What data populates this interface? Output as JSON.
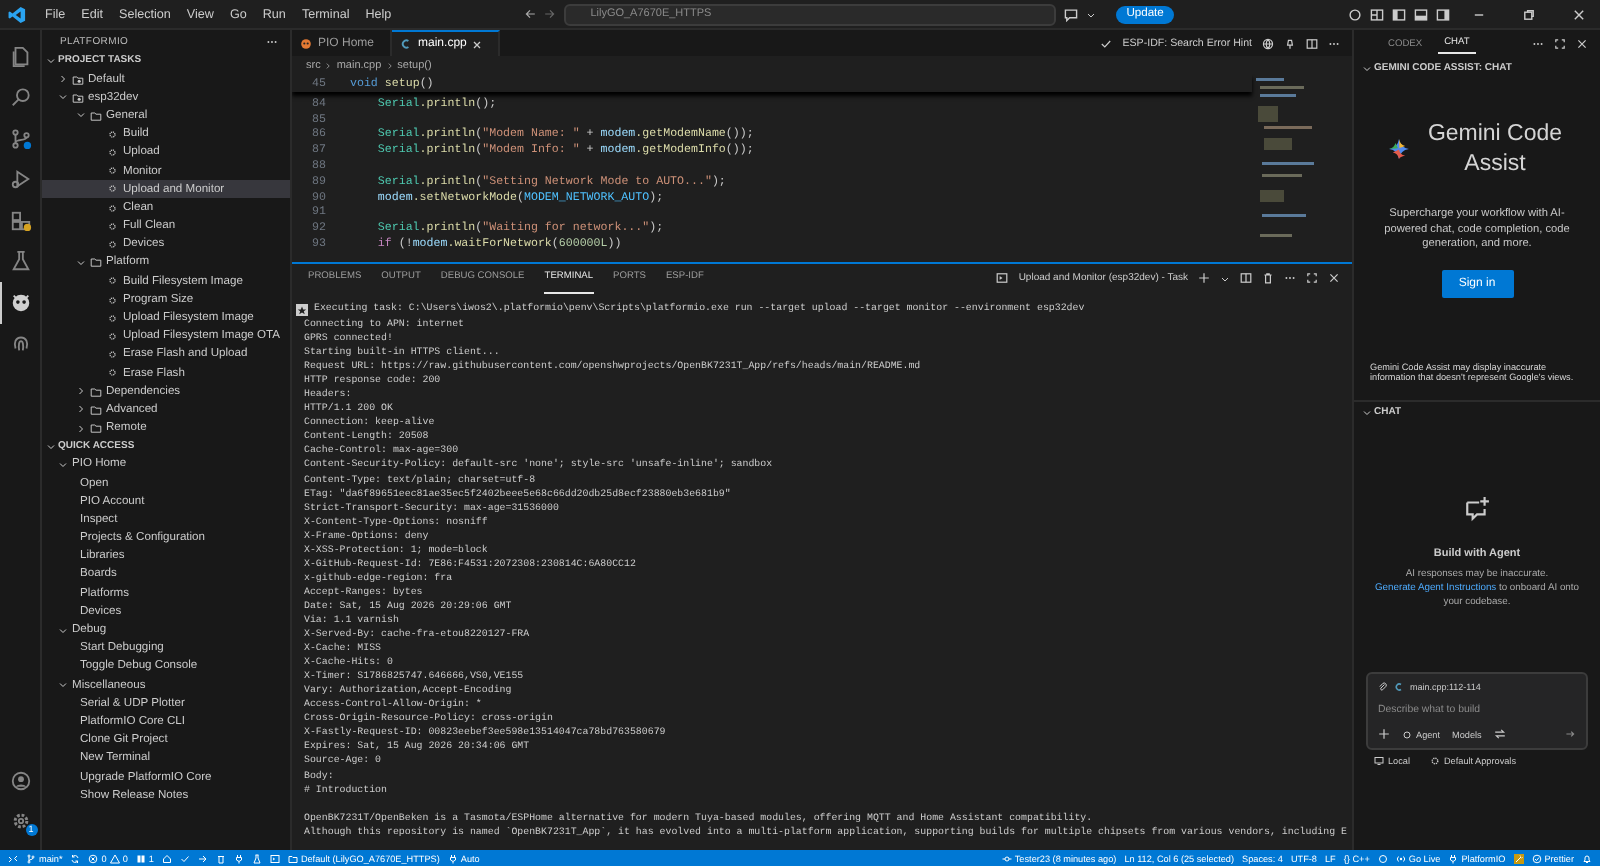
{
  "title_bar": {
    "menu": [
      "File",
      "Edit",
      "Selection",
      "View",
      "Go",
      "Run",
      "Terminal",
      "Help"
    ],
    "command_center": "LilyGO_A7670E_HTTPS",
    "update_button": "Update"
  },
  "activity_bar": {
    "items": [
      {
        "kind": "explorer",
        "selected": false
      },
      {
        "kind": "search",
        "selected": false
      },
      {
        "kind": "source-control",
        "selected": false
      },
      {
        "kind": "run",
        "selected": false
      },
      {
        "kind": "extensions",
        "selected": false
      },
      {
        "kind": "testing",
        "selected": false
      },
      {
        "kind": "platformio",
        "selected": true
      },
      {
        "kind": "fingerprint",
        "selected": false
      }
    ],
    "settings_badge": "1"
  },
  "sidebar": {
    "title": "PLATFORMIO",
    "project_tasks_header": "PROJECT TASKS",
    "project_tasks": [
      {
        "label": "Default",
        "kind": "env",
        "expanded": false,
        "selected": false
      },
      {
        "label": "esp32dev",
        "kind": "env",
        "expanded": true,
        "selected": false,
        "children": [
          {
            "label": "General",
            "kind": "folder",
            "expanded": true,
            "selected": false,
            "children": [
              {
                "label": "Build",
                "kind": "task",
                "selected": false
              },
              {
                "label": "Upload",
                "kind": "task",
                "selected": false
              },
              {
                "label": "Monitor",
                "kind": "task",
                "selected": false
              },
              {
                "label": "Upload and Monitor",
                "kind": "task",
                "selected": true
              },
              {
                "label": "Clean",
                "kind": "task",
                "selected": false
              },
              {
                "label": "Full Clean",
                "kind": "task",
                "selected": false
              },
              {
                "label": "Devices",
                "kind": "task",
                "selected": false
              }
            ]
          },
          {
            "label": "Platform",
            "kind": "folder",
            "expanded": true,
            "selected": false,
            "children": [
              {
                "label": "Build Filesystem Image",
                "kind": "task",
                "selected": false
              },
              {
                "label": "Program Size",
                "kind": "task",
                "selected": false
              },
              {
                "label": "Upload Filesystem Image",
                "kind": "task",
                "selected": false
              },
              {
                "label": "Upload Filesystem Image OTA",
                "kind": "task",
                "selected": false
              },
              {
                "label": "Erase Flash and Upload",
                "kind": "task",
                "selected": false
              },
              {
                "label": "Erase Flash",
                "kind": "task",
                "selected": false
              }
            ]
          },
          {
            "label": "Dependencies",
            "kind": "folder",
            "expanded": false,
            "selected": false
          },
          {
            "label": "Advanced",
            "kind": "folder",
            "expanded": false,
            "selected": false
          },
          {
            "label": "Remote",
            "kind": "folder",
            "expanded": false,
            "selected": false
          }
        ]
      }
    ],
    "quick_access_header": "QUICK ACCESS",
    "quick_access": [
      {
        "label": "PIO Home",
        "expanded": true,
        "children": [
          {
            "label": "Open"
          },
          {
            "label": "PIO Account"
          },
          {
            "label": "Inspect"
          },
          {
            "label": "Projects & Configuration"
          },
          {
            "label": "Libraries"
          },
          {
            "label": "Boards"
          },
          {
            "label": "Platforms"
          },
          {
            "label": "Devices"
          }
        ]
      },
      {
        "label": "Debug",
        "expanded": true,
        "children": [
          {
            "label": "Start Debugging"
          },
          {
            "label": "Toggle Debug Console"
          }
        ]
      },
      {
        "label": "Miscellaneous",
        "expanded": true,
        "children": [
          {
            "label": "Serial & UDP Plotter"
          },
          {
            "label": "PlatformIO Core CLI"
          },
          {
            "label": "Clone Git Project"
          },
          {
            "label": "New Terminal"
          },
          {
            "label": "Upgrade PlatformIO Core"
          },
          {
            "label": "Show Release Notes"
          }
        ]
      }
    ]
  },
  "editor": {
    "tabs": [
      {
        "label": "PIO Home",
        "kind": "home",
        "selected": false
      },
      {
        "label": "main.cpp",
        "kind": "cpp",
        "selected": true
      }
    ],
    "action_label": "ESP-IDF: Search Error Hint",
    "breadcrumb": [
      "src",
      "main.cpp",
      "setup()"
    ],
    "sticky_line": {
      "number": "45",
      "tokens": [
        {
          "text": "void ",
          "kind": "kw"
        },
        {
          "text": "setup",
          "kind": "fn"
        },
        {
          "text": "()",
          "kind": "plain"
        }
      ]
    },
    "lines": [
      {
        "number": "84",
        "tokens": [
          {
            "text": "    Serial",
            "kind": "type"
          },
          {
            "text": ".println",
            "kind": "fn"
          },
          {
            "text": "();",
            "kind": "plain"
          }
        ]
      },
      {
        "number": "85"
      },
      {
        "number": "86",
        "tokens": [
          {
            "text": "    Serial",
            "kind": "type"
          },
          {
            "text": ".println",
            "kind": "fn"
          },
          {
            "text": "(",
            "kind": "plain"
          },
          {
            "text": "\"Modem Name: \"",
            "kind": "str"
          },
          {
            "text": " + ",
            "kind": "plain"
          },
          {
            "text": "modem",
            "kind": "var"
          },
          {
            "text": ".getModemName",
            "kind": "fn"
          },
          {
            "text": "());",
            "kind": "plain"
          }
        ]
      },
      {
        "number": "87",
        "tokens": [
          {
            "text": "    Serial",
            "kind": "type"
          },
          {
            "text": ".println",
            "kind": "fn"
          },
          {
            "text": "(",
            "kind": "plain"
          },
          {
            "text": "\"Modem Info: \"",
            "kind": "str"
          },
          {
            "text": " + ",
            "kind": "plain"
          },
          {
            "text": "modem",
            "kind": "var"
          },
          {
            "text": ".getModemInfo",
            "kind": "fn"
          },
          {
            "text": "());",
            "kind": "plain"
          }
        ]
      },
      {
        "number": "88"
      },
      {
        "number": "89",
        "tokens": [
          {
            "text": "    Serial",
            "kind": "type"
          },
          {
            "text": ".println",
            "kind": "fn"
          },
          {
            "text": "(",
            "kind": "plain"
          },
          {
            "text": "\"Setting Network Mode to AUTO...\"",
            "kind": "str"
          },
          {
            "text": ");",
            "kind": "plain"
          }
        ]
      },
      {
        "number": "90",
        "tokens": [
          {
            "text": "    modem",
            "kind": "var"
          },
          {
            "text": ".setNetworkMode",
            "kind": "fn"
          },
          {
            "text": "(",
            "kind": "plain"
          },
          {
            "text": "MODEM_NETWORK_AUTO",
            "kind": "const"
          },
          {
            "text": ");",
            "kind": "plain"
          }
        ]
      },
      {
        "number": "91"
      },
      {
        "number": "92",
        "tokens": [
          {
            "text": "    Serial",
            "kind": "type"
          },
          {
            "text": ".println",
            "kind": "fn"
          },
          {
            "text": "(",
            "kind": "plain"
          },
          {
            "text": "\"Waiting for network...\"",
            "kind": "str"
          },
          {
            "text": ");",
            "kind": "plain"
          }
        ]
      },
      {
        "number": "93",
        "tokens": [
          {
            "text": "    if",
            "kind": "ctl"
          },
          {
            "text": " (!",
            "kind": "plain"
          },
          {
            "text": "modem",
            "kind": "var"
          },
          {
            "text": ".waitForNetwork",
            "kind": "fn"
          },
          {
            "text": "(",
            "kind": "plain"
          },
          {
            "text": "600000L",
            "kind": "num"
          },
          {
            "text": "))",
            "kind": "plain"
          }
        ]
      }
    ]
  },
  "panel": {
    "tabs": [
      {
        "label": "PROBLEMS",
        "selected": false
      },
      {
        "label": "OUTPUT",
        "selected": false
      },
      {
        "label": "DEBUG CONSOLE",
        "selected": false
      },
      {
        "label": "TERMINAL",
        "selected": true
      },
      {
        "label": "PORTS",
        "selected": false
      },
      {
        "label": "ESP-IDF",
        "selected": false
      }
    ],
    "terminal_name": "Upload and Monitor (esp32dev) - Task",
    "command": "Executing task: C:\\Users\\iwos2\\.platformio\\penv\\Scripts\\platformio.exe run --target upload --target monitor --environment esp32dev",
    "output_blocks": [
      [
        "Connecting to APN: internet",
        "GPRS connected!",
        "Starting built-in HTTPS client...",
        "Request URL: https://raw.githubusercontent.com/openshwprojects/OpenBK7231T_App/refs/heads/main/README.md",
        "HTTP response code: 200",
        "Headers:",
        "HTTP/1.1 200 OK",
        "Connection: keep-alive",
        "Content-Length: 20508",
        "Cache-Control: max-age=300",
        "Content-Security-Policy: default-src 'none'; style-src 'unsafe-inline'; sandbox",
        "Content-Type: text/plain; charset=utf-8",
        "ETag: \"da6f89651eec81ae35ec5f2402beee5e68c66dd20db25d8ecf23880eb3e681b9\"",
        "Strict-Transport-Security: max-age=31536000",
        "X-Content-Type-Options: nosniff",
        "X-Frame-Options: deny",
        "X-XSS-Protection: 1; mode=block",
        "X-GitHub-Request-Id: 7E86:F4531:2072308:230814C:6A80CC12",
        "x-github-edge-region: fra",
        "Accept-Ranges: bytes",
        "Date: Sat, 15 Aug 2026 20:29:06 GMT",
        "Via: 1.1 varnish",
        "X-Served-By: cache-fra-etou8220127-FRA",
        "X-Cache: MISS",
        "X-Cache-Hits: 0",
        "X-Timer: S1786825747.646666,VS0,VE155",
        "Vary: Authorization,Accept-Encoding",
        "Access-Control-Allow-Origin: *",
        "Cross-Origin-Resource-Policy: cross-origin",
        "X-Fastly-Request-ID: 00823eebef3ee598e13514047ca78bd763580679",
        "Expires: Sat, 15 Aug 2026 20:34:06 GMT",
        "Source-Age: 0",
        "Body:",
        "# Introduction"
      ],
      [
        "OpenBK7231T/OpenBeken is a Tasmota/ESPHome alternative for modern Tuya-based modules, offering MQTT and Home Assistant compatibility.",
        "Although this repository is named `OpenBK7231T_App`, it has evolved into a multi-platform application, supporting builds for multiple chipsets from various vendors, including E"
      ]
    ]
  },
  "assistant": {
    "tabs": [
      {
        "label": "CODEX",
        "selected": false
      },
      {
        "label": "CHAT",
        "selected": true
      }
    ],
    "header": "GEMINI CODE ASSIST: CHAT",
    "product_name": "Gemini Code Assist",
    "tagline": "Supercharge your workflow with AI-powered chat, code completion, code generation, and more.",
    "sign_in_button": "Sign in",
    "disclaimer": "Gemini Code Assist may display inaccurate information that doesn't represent Google's views.",
    "chat_header": "CHAT",
    "agent_title": "Build with Agent",
    "agent_note": "AI responses may be inaccurate.",
    "agent_link": "Generate Agent Instructions",
    "agent_note_end": "to onboard AI onto your codebase.",
    "context_chip": "main.cpp:112-114",
    "input": {
      "placeholder": "Describe what to build"
    },
    "mode": "Agent",
    "models": "Models",
    "footer": [
      "Local",
      "Default Approvals"
    ]
  },
  "status_bar": {
    "branch": "main*",
    "errors": "0",
    "warnings": "0",
    "tasks": "1",
    "environment": "Default (LilyGO_A7670E_HTTPS)",
    "port": "Auto",
    "blame": "Tester23 (8 minutes ago)",
    "cursor": "Ln 112, Col 6 (25 selected)",
    "indentation": "Spaces: 4",
    "encoding": "UTF-8",
    "eol": "LF",
    "language": "{} C++",
    "go_live": "Go Live",
    "platformio": "PlatformIO",
    "prettier": "Prettier"
  }
}
